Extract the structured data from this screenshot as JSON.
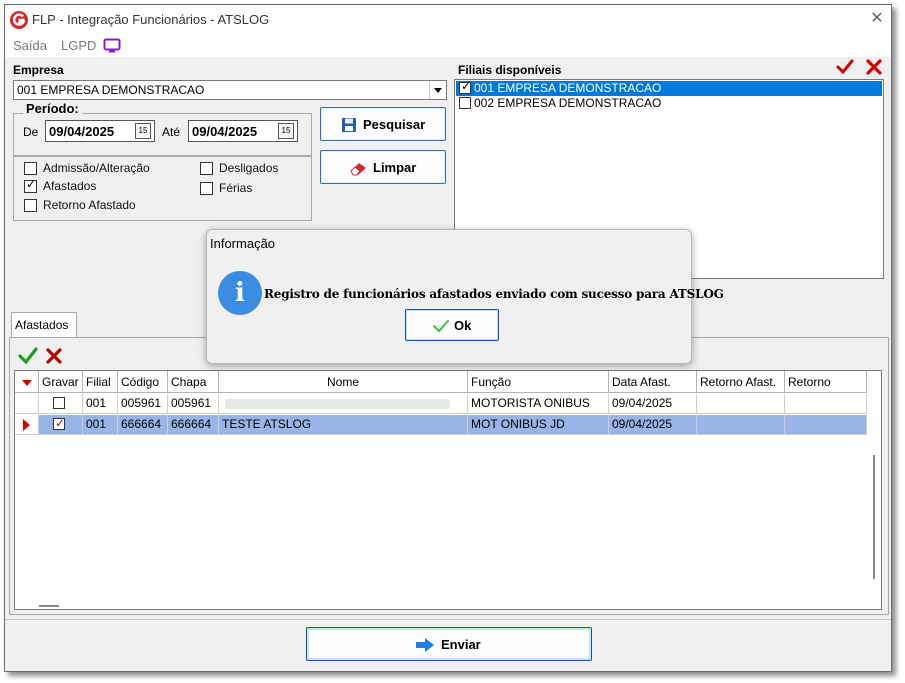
{
  "window": {
    "title": "FLP - Integração Funcionários - ATSLOG",
    "close_glyph": "✕"
  },
  "menu": {
    "items": [
      "Saída",
      "LGPD"
    ]
  },
  "empresa": {
    "label": "Empresa",
    "selected": "001 EMPRESA DEMONSTRACAO"
  },
  "periodo": {
    "label": "Período:",
    "from_label": "De",
    "from_value": "09/04/2025",
    "to_label": "Até",
    "to_value": "09/04/2025",
    "calendar_glyph": "15"
  },
  "buttons": {
    "pesquisar": "Pesquisar",
    "limpar": "Limpar",
    "enviar": "Enviar"
  },
  "filters": {
    "admissao": {
      "label": "Admissão/Alteração",
      "checked": false
    },
    "afastados": {
      "label": "Afastados",
      "checked": true
    },
    "retorno": {
      "label": "Retorno Afastado",
      "checked": false
    },
    "desligados": {
      "label": "Desligados",
      "checked": false
    },
    "ferias": {
      "label": "Férias",
      "checked": false
    }
  },
  "filiais": {
    "label": "Filiais disponíveis",
    "items": [
      {
        "label": "001 EMPRESA DEMONSTRACAO",
        "checked": true,
        "selected": true
      },
      {
        "label": "002 EMPRESA DEMONSTRACAO",
        "checked": false,
        "selected": false
      }
    ]
  },
  "tabs": {
    "afastados": "Afastados"
  },
  "grid": {
    "headers": [
      "Gravar",
      "Filial",
      "Código",
      "Chapa",
      "Nome",
      "Função",
      "Data Afast.",
      "Retorno Afast.",
      "Retorno"
    ],
    "rows": [
      {
        "gravar": false,
        "filial": "001",
        "codigo": "005961",
        "chapa": "005961",
        "nome": "",
        "funcao": "MOTORISTA ONIBUS",
        "data_afast": "09/04/2025",
        "retorno_afast": "",
        "retorno": ""
      },
      {
        "gravar": true,
        "filial": "001",
        "codigo": "666664",
        "chapa": "666664",
        "nome": "TESTE ATSLOG",
        "funcao": "MOT ONIBUS JD",
        "data_afast": "09/04/2025",
        "retorno_afast": "",
        "retorno": ""
      }
    ]
  },
  "dialog": {
    "title": "Informação",
    "message": "Registro de funcionários afastados enviado com sucesso para ATSLOG",
    "ok_label": "Ok",
    "info_glyph": "i"
  },
  "colors": {
    "accent": "#0078d7",
    "selected_row": "#99b4e6",
    "check_red": "#d40000",
    "check_green": "#1e9e1e"
  }
}
